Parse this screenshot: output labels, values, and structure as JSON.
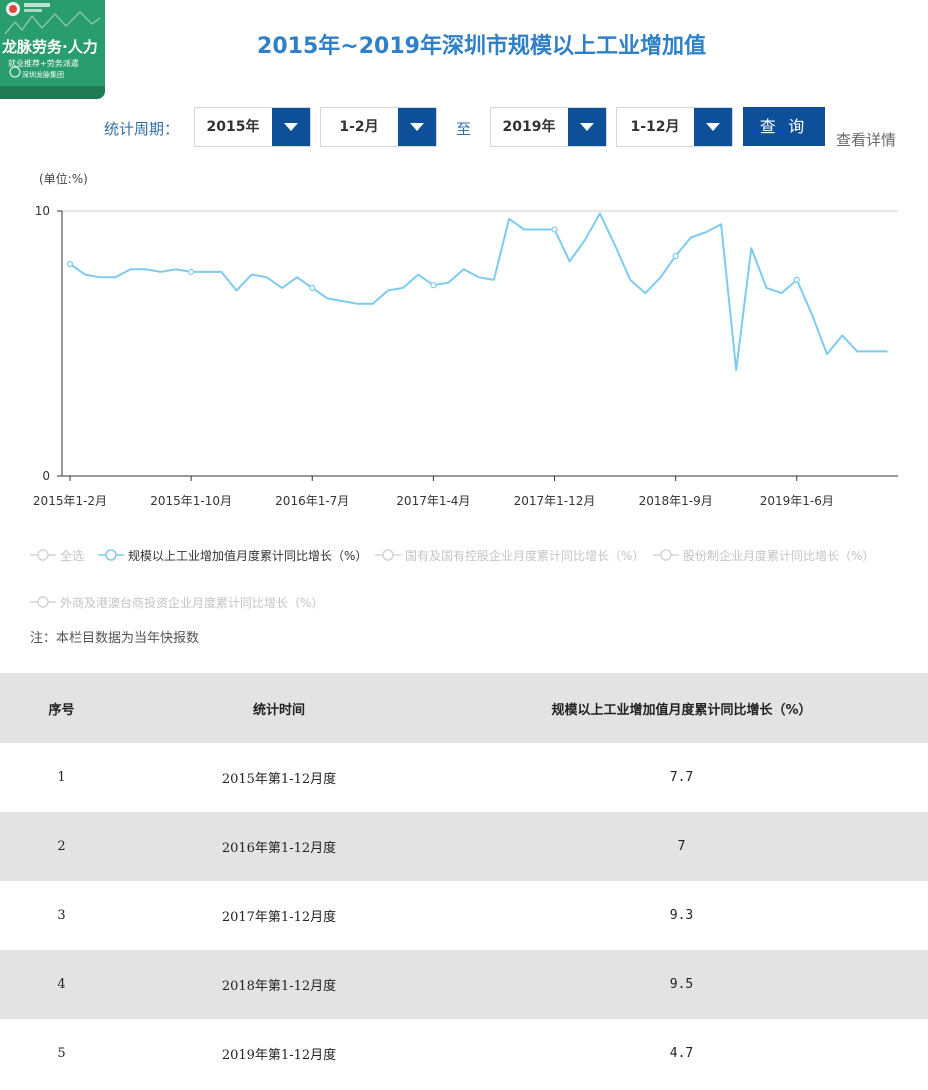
{
  "logo": {
    "brand": "龙脉劳务·人力",
    "tagline": "就业推荐+劳务派遣",
    "org": "深圳龙脉集团"
  },
  "page_title": "2015年~2019年深圳市规模以上工业增加值",
  "query": {
    "label": "统计周期：",
    "start_year": "2015年",
    "start_month": "1-2月",
    "to": "至",
    "end_year": "2019年",
    "end_month": "1-12月",
    "button": "查 询",
    "detail": "查看详情"
  },
  "unit": "(单位:%)",
  "chart_data": {
    "type": "line",
    "ylim": [
      0,
      10
    ],
    "yticks": [
      "0",
      "10"
    ],
    "xtick_labels": [
      "2015年1-2月",
      "2015年1-10月",
      "2016年1-7月",
      "2017年1-4月",
      "2017年1-12月",
      "2018年1-9月",
      "2019年1-6月"
    ],
    "xtick_indices": [
      0,
      8,
      16,
      24,
      32,
      40,
      48
    ],
    "grid": "horizontal",
    "legend_position": "bottom",
    "color": "#7ecbf0",
    "series": [
      {
        "name": "规模以上工业增加值月度累计同比增长（%）",
        "x": [
          "2015年1-2月",
          "2015年1-3月",
          "2015年1-4月",
          "2015年1-5月",
          "2015年1-6月",
          "2015年1-7月",
          "2015年1-8月",
          "2015年1-9月",
          "2015年1-10月",
          "2015年1-11月",
          "2015年1-12月",
          "2016年1-2月",
          "2016年1-3月",
          "2016年1-4月",
          "2016年1-5月",
          "2016年1-6月",
          "2016年1-7月",
          "2016年1-8月",
          "2016年1-9月",
          "2016年1-10月",
          "2016年1-11月",
          "2016年1-12月",
          "2017年1-2月",
          "2017年1-3月",
          "2017年1-4月",
          "2017年1-5月",
          "2017年1-6月",
          "2017年1-7月",
          "2017年1-8月",
          "2017年1-9月",
          "2017年1-10月",
          "2017年1-11月",
          "2017年1-12月",
          "2018年1-2月",
          "2018年1-3月",
          "2018年1-4月",
          "2018年1-5月",
          "2018年1-6月",
          "2018年1-7月",
          "2018年1-8月",
          "2018年1-9月",
          "2018年1-10月",
          "2018年1-11月",
          "2018年1-12月",
          "2019年1-2月",
          "2019年1-3月",
          "2019年1-4月",
          "2019年1-5月",
          "2019年1-6月",
          "2019年1-7月",
          "2019年1-8月",
          "2019年1-9月",
          "2019年1-10月",
          "2019年1-11月",
          "2019年1-12月"
        ],
        "values": [
          8.0,
          7.6,
          7.5,
          7.5,
          7.8,
          7.8,
          7.7,
          7.8,
          7.7,
          7.7,
          7.7,
          7.0,
          7.6,
          7.5,
          7.1,
          7.5,
          7.1,
          6.7,
          6.6,
          6.5,
          6.5,
          7.0,
          7.1,
          7.6,
          7.2,
          7.3,
          7.8,
          7.5,
          7.4,
          9.7,
          9.3,
          9.3,
          9.3,
          8.1,
          8.9,
          9.9,
          8.7,
          7.4,
          6.9,
          7.5,
          8.3,
          9.0,
          9.2,
          9.5,
          4.0,
          8.6,
          7.1,
          6.9,
          7.4,
          6.1,
          4.6,
          5.3,
          4.7,
          4.7,
          4.7
        ]
      }
    ],
    "marker_indices": [
      0,
      8,
      16,
      24,
      32,
      40,
      48
    ]
  },
  "legend": {
    "items": [
      {
        "label": "全选",
        "active": false
      },
      {
        "label": "规模以上工业增加值月度累计同比增长（%）",
        "active": true
      },
      {
        "label": "国有及国有控股企业月度累计同比增长（%）",
        "active": false
      },
      {
        "label": "股份制企业月度累计同比增长（%）",
        "active": false
      },
      {
        "label": "外商及港澳台商投资企业月度累计同比增长（%）",
        "active": false
      }
    ]
  },
  "note": "注：本栏目数据为当年快报数",
  "table": {
    "headers": [
      "序号",
      "统计时间",
      "规模以上工业增加值月度累计同比增长（%）"
    ],
    "rows": [
      [
        "1",
        "2015年第1-12月度",
        "7.7"
      ],
      [
        "2",
        "2016年第1-12月度",
        "7"
      ],
      [
        "3",
        "2017年第1-12月度",
        "9.3"
      ],
      [
        "4",
        "2018年第1-12月度",
        "9.5"
      ],
      [
        "5",
        "2019年第1-12月度",
        "4.7"
      ]
    ]
  }
}
